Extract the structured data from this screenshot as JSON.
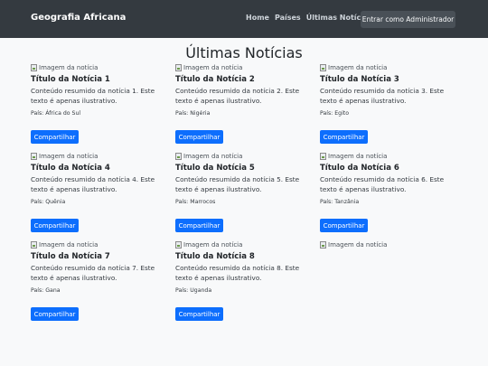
{
  "navbar": {
    "brand": "Geografia Africana",
    "links": [
      "Home",
      "Países",
      "Últimas Notícias"
    ],
    "admin_button": "Entrar como Administrador"
  },
  "page_title": "Últimas Notícias",
  "share_label": "Compartilhar",
  "image_alt": "Imagem da notícia",
  "news": [
    {
      "title": "Título da Notícia 1",
      "text": "Conteúdo resumido da notícia 1. Este texto é apenas ilustrativo.",
      "country": "País: África do Sul"
    },
    {
      "title": "Título da Notícia 2",
      "text": "Conteúdo resumido da notícia 2. Este texto é apenas ilustrativo.",
      "country": "País: Nigéria"
    },
    {
      "title": "Título da Notícia 3",
      "text": "Conteúdo resumido da notícia 3. Este texto é apenas ilustrativo.",
      "country": "País: Egito"
    },
    {
      "title": "Título da Notícia 4",
      "text": "Conteúdo resumido da notícia 4. Este texto é apenas ilustrativo.",
      "country": "País: Quênia"
    },
    {
      "title": "Título da Notícia 5",
      "text": "Conteúdo resumido da notícia 5. Este texto é apenas ilustrativo.",
      "country": "País: Marrocos"
    },
    {
      "title": "Título da Notícia 6",
      "text": "Conteúdo resumido da notícia 6. Este texto é apenas ilustrativo.",
      "country": "País: Tanzânia"
    },
    {
      "title": "Título da Notícia 7",
      "text": "Conteúdo resumido da notícia 7. Este texto é apenas ilustrativo.",
      "country": "País: Gana"
    },
    {
      "title": "Título da Notícia 8",
      "text": "Conteúdo resumido da notícia 8. Este texto é apenas ilustrativo.",
      "country": "País: Uganda"
    },
    {
      "title": "",
      "text": "",
      "country": ""
    }
  ],
  "colors": {
    "navbar_bg": "#343a40",
    "page_bg": "#f8f9fa",
    "primary_button": "#0d6efd"
  }
}
